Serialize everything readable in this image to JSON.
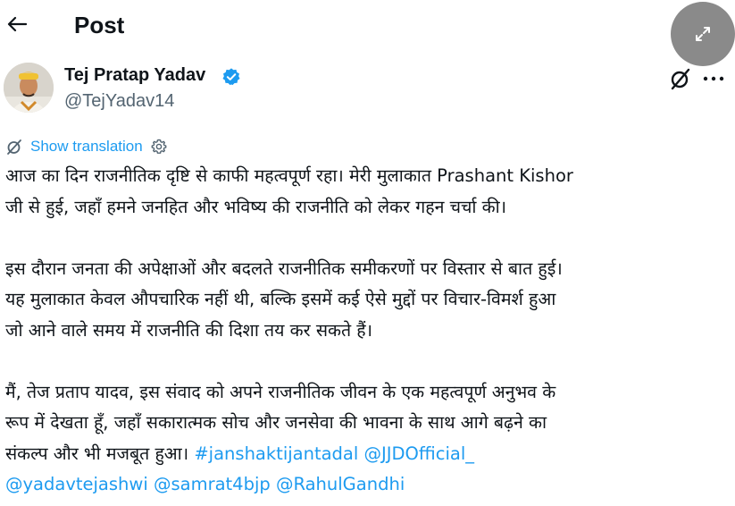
{
  "header": {
    "title": "Post"
  },
  "author": {
    "name": "Tej Pratap Yadav",
    "handle": "@TejYadav14",
    "verified": true
  },
  "translation": {
    "label": "Show translation"
  },
  "tweet": {
    "lines": [
      "आज का दिन राजनीतिक दृष्टि से काफी महत्वपूर्ण रहा। मेरी मुलाकात Prashant Kishor",
      "जी से हुई, जहाँ हमने जनहित और भविष्य की राजनीति को लेकर गहन चर्चा की।",
      "",
      "इस दौरान जनता की अपेक्षाओं और बदलते राजनीतिक समीकरणों पर विस्तार से बात हुई।",
      "यह मुलाकात केवल औपचारिक नहीं थी, बल्कि इसमें कई ऐसे मुद्दों पर विचार-विमर्श हुआ",
      "जो आने वाले समय में राजनीति की दिशा तय कर सकते हैं।",
      "",
      "मैं, तेज प्रताप यादव, इस संवाद को अपने राजनीतिक जीवन के एक महत्वपूर्ण अनुभव के",
      "रूप में देखता हूँ, जहाँ सकारात्मक सोच और जनसेवा की भावना के साथ आगे बढ़ने का"
    ],
    "last_line_text": "संकल्प और भी मजबूत हुआ।",
    "hashtag": "#janshaktijantadal",
    "mention_jjd": "@JJDOfficial_",
    "mentions_line": [
      "@yadavtejashwi",
      "@samrat4bjp",
      "@RahulGandhi"
    ]
  },
  "colors": {
    "link": "#1d9bf0",
    "text": "#0f1419",
    "secondary": "#536471",
    "overlay_button": "#8a8a8a"
  },
  "icons": {
    "back": "arrow-left-icon",
    "expand": "expand-icon",
    "verified": "verified-badge-icon",
    "grok": "grok-icon",
    "more": "more-icon",
    "translate": "translate-slash-icon",
    "settings": "gear-icon"
  }
}
